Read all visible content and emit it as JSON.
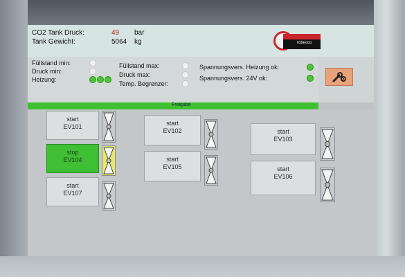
{
  "header": {
    "co2_label": "CO2 Tank Druck:",
    "co2_value": "49",
    "co2_unit": "bar",
    "weight_label": "Tank Gewicht:",
    "weight_value": "5064",
    "weight_unit": "kg",
    "logo_text": "robecco"
  },
  "status": {
    "fuellstand_min": "Füllstand min:",
    "druck_min": "Druck min:",
    "heizung": "Heizung:",
    "fuellstand_max": "Füllstand max:",
    "druck_max": "Druck max:",
    "temp_begrenzer": "Temp. Begrenzer:",
    "spannung_heizung": "Spannungsvers. Heizung ok:",
    "spannung_24v": "Spannungsvers.  24V ok:"
  },
  "freigabe": "Freigabe",
  "valves": [
    {
      "action": "start",
      "id": "EV101",
      "state": "off"
    },
    {
      "action": "stop",
      "id": "EV104",
      "state": "on"
    },
    {
      "action": "start",
      "id": "EV107",
      "state": "off"
    },
    {
      "action": "start",
      "id": "EV102",
      "state": "off"
    },
    {
      "action": "start",
      "id": "EV105",
      "state": "off"
    },
    {
      "action": "start",
      "id": "EV103",
      "state": "off"
    },
    {
      "action": "start",
      "id": "EV106",
      "state": "off"
    }
  ],
  "colors": {
    "accent_green": "#3fc032",
    "tool_button": "#e9a27a",
    "brand_red": "#c9262d"
  },
  "icons": {
    "tool_button": "wrench-gear-icon",
    "valve": "valve-icon"
  }
}
